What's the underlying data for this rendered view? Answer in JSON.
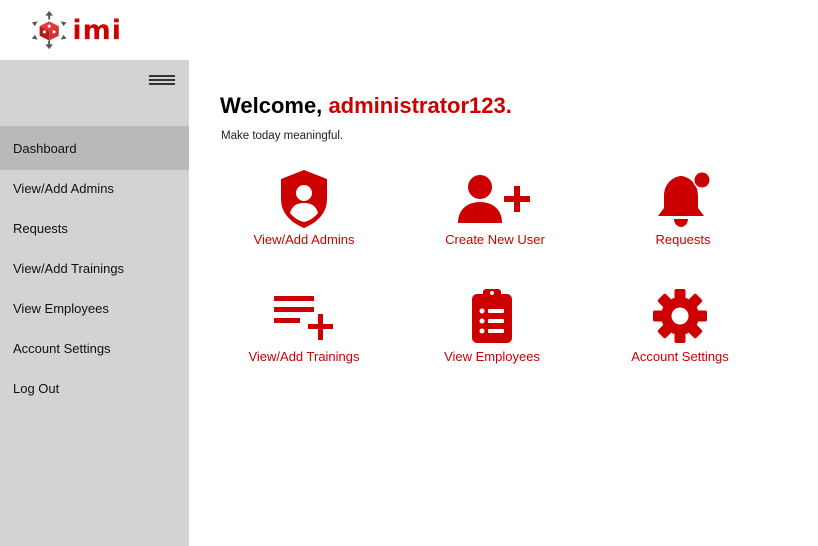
{
  "brand": {
    "logo_text": "imi",
    "accent": "#cc0000"
  },
  "sidebar": {
    "menu_icon": "hamburger-menu-icon",
    "items": [
      {
        "label": "Dashboard",
        "active": true
      },
      {
        "label": "View/Add Admins",
        "active": false
      },
      {
        "label": "Requests",
        "active": false
      },
      {
        "label": "View/Add Trainings",
        "active": false
      },
      {
        "label": "View Employees",
        "active": false
      },
      {
        "label": "Account Settings",
        "active": false
      },
      {
        "label": "Log Out",
        "active": false
      }
    ]
  },
  "main": {
    "welcome_prefix": "Welcome,",
    "username": "administrator123.",
    "tagline": "Make today meaningful.",
    "tiles": [
      {
        "label": "View/Add Admins",
        "icon": "user-shield-icon"
      },
      {
        "label": "Create New User",
        "icon": "user-plus-icon"
      },
      {
        "label": "Requests",
        "icon": "bell-notification-icon"
      },
      {
        "label": "View/Add Trainings",
        "icon": "playlist-add-icon"
      },
      {
        "label": "View Employees",
        "icon": "clipboard-list-icon"
      },
      {
        "label": "Account Settings",
        "icon": "gear-icon"
      }
    ]
  }
}
